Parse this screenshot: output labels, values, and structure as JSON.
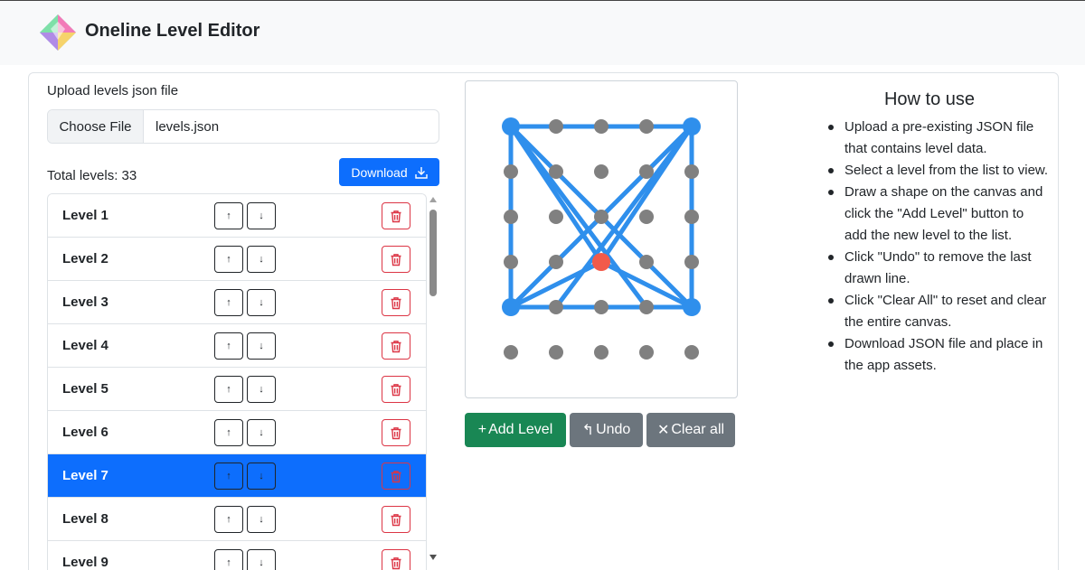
{
  "header": {
    "title": "Oneline Level Editor",
    "logo_icon": "diamond-logo-icon"
  },
  "upload": {
    "label": "Upload levels json file",
    "choose_file_label": "Choose File",
    "file_name": "levels.json"
  },
  "levels": {
    "total_label": "Total levels: 33",
    "download_label": "Download",
    "items": [
      {
        "label": "Level 1",
        "up": "↑",
        "down": "↓"
      },
      {
        "label": "Level 2",
        "up": "↑",
        "down": "↓"
      },
      {
        "label": "Level 3",
        "up": "↑",
        "down": "↓"
      },
      {
        "label": "Level 4",
        "up": "↑",
        "down": "↓"
      },
      {
        "label": "Level 5",
        "up": "↑",
        "down": "↓"
      },
      {
        "label": "Level 6",
        "up": "↑",
        "down": "↓"
      },
      {
        "label": "Level 7",
        "up": "↑",
        "down": "↓"
      },
      {
        "label": "Level 8",
        "up": "↑",
        "down": "↓"
      },
      {
        "label": "Level 9",
        "up": "↑",
        "down": "↓"
      }
    ],
    "selected": "Level 7"
  },
  "canvas": {
    "grid_columns": 5,
    "grid_rows": 6,
    "dot_color": "#808080",
    "line_color": "#2f8fec",
    "current_point_color": "#f25a4a",
    "current_point": [
      2,
      3
    ],
    "edges": [
      [
        [
          0,
          0
        ],
        [
          4,
          0
        ]
      ],
      [
        [
          0,
          0
        ],
        [
          0,
          4
        ]
      ],
      [
        [
          4,
          0
        ],
        [
          4,
          4
        ]
      ],
      [
        [
          0,
          4
        ],
        [
          4,
          4
        ]
      ],
      [
        [
          0,
          0
        ],
        [
          3,
          4
        ]
      ],
      [
        [
          4,
          0
        ],
        [
          1,
          4
        ]
      ],
      [
        [
          0,
          0
        ],
        [
          2,
          3
        ]
      ],
      [
        [
          4,
          0
        ],
        [
          2,
          3
        ]
      ],
      [
        [
          0,
          4
        ],
        [
          2,
          3
        ]
      ],
      [
        [
          4,
          4
        ],
        [
          2,
          3
        ]
      ],
      [
        [
          0,
          4
        ],
        [
          4,
          0
        ]
      ],
      [
        [
          4,
          4
        ],
        [
          0,
          0
        ]
      ]
    ]
  },
  "actions": {
    "add_label": "Add Level",
    "add_symbol": "+",
    "undo_label": "Undo",
    "undo_symbol": "↰",
    "clear_label": "Clear all",
    "clear_symbol": "✕"
  },
  "help": {
    "title": "How to use",
    "items": [
      "Upload a pre-existing JSON file that contains level data.",
      "Select a level from the list to view.",
      "Draw a shape on the canvas and click the \"Add Level\" button to add the new level to the list.",
      "Click \"Undo\" to remove the last drawn line.",
      "Click \"Clear All\" to reset and clear the entire canvas.",
      "Download JSON file and place in the app assets."
    ]
  }
}
